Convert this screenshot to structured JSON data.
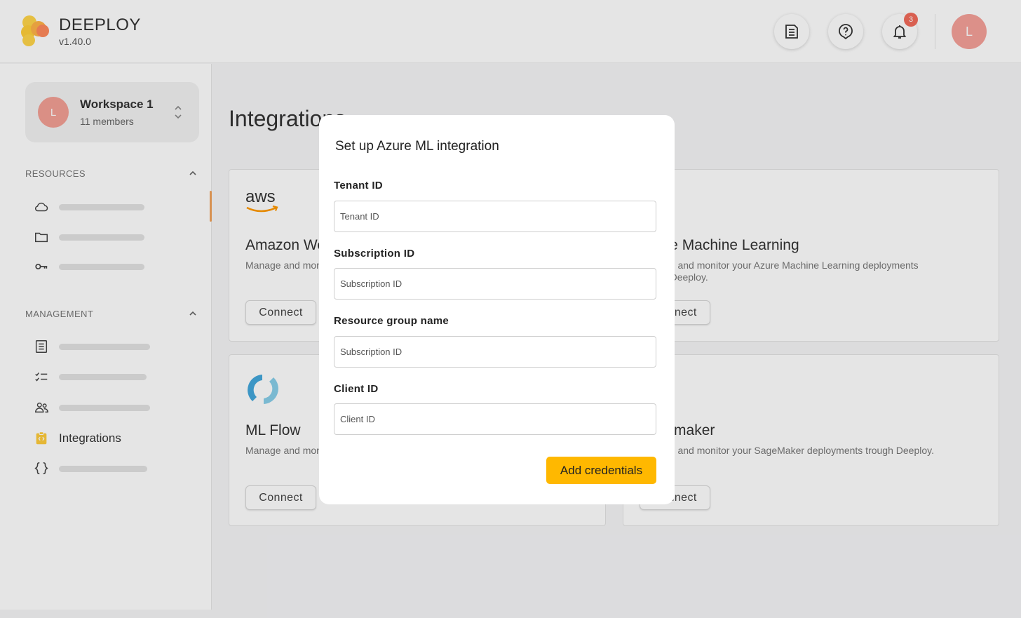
{
  "app": {
    "name": "DEEPLOY",
    "version": "v1.40.0"
  },
  "header": {
    "icons": [
      "docs-icon",
      "help-icon",
      "bell-icon"
    ],
    "notification_count": "3",
    "user_initial": "L"
  },
  "workspace": {
    "initial": "L",
    "name": "Workspace 1",
    "members": "11 members"
  },
  "sidebar": {
    "resources_title": "RESOURCES",
    "resources_icons": [
      "cloud-icon",
      "folder-icon",
      "key-icon"
    ],
    "management_title": "MANAGEMENT",
    "management_icons": [
      "list-icon",
      "checklist-icon",
      "users-icon",
      "integrations-icon",
      "braces-icon"
    ],
    "active_item_label": "Integrations"
  },
  "main": {
    "title": "Integrations",
    "cards": [
      {
        "logo": "aws-logo",
        "title": "Amazon Web Services",
        "desc1": "Manage and monitor your AWS deployments trough Deeploy.",
        "desc2": "",
        "button": "Connect"
      },
      {
        "logo": "azure-logo",
        "title": "Azure Machine Learning",
        "desc1": "Manage and monitor your Azure Machine Learning deployments",
        "desc2": "trough Deeploy.",
        "button": "Connect"
      },
      {
        "logo": "mlflow-logo",
        "title": "ML Flow",
        "desc1": "Manage and monitor your ML Flow deployments trough Deeploy.",
        "desc2": "",
        "button": "Connect"
      },
      {
        "logo": "sagemaker-logo",
        "title": "Sagemaker",
        "desc1": "Manage and monitor your SageMaker deployments trough Deeploy.",
        "desc2": "",
        "button": "Connect"
      }
    ]
  },
  "modal": {
    "title": "Set up Azure ML integration",
    "fields": [
      {
        "label": "Tenant ID",
        "placeholder": "Tenant ID"
      },
      {
        "label": "Subscription ID",
        "placeholder": "Subscription ID"
      },
      {
        "label": "Resource group name",
        "placeholder": "Subscription ID"
      },
      {
        "label": "Client ID",
        "placeholder": "Client ID"
      }
    ],
    "submit_label": "Add credentials"
  },
  "colors": {
    "accent": "#ffb800",
    "avatar": "#f3a095",
    "badge": "#f26b5b",
    "aws_orange": "#ff9900",
    "mlflow_blue": "#43a8dc"
  }
}
